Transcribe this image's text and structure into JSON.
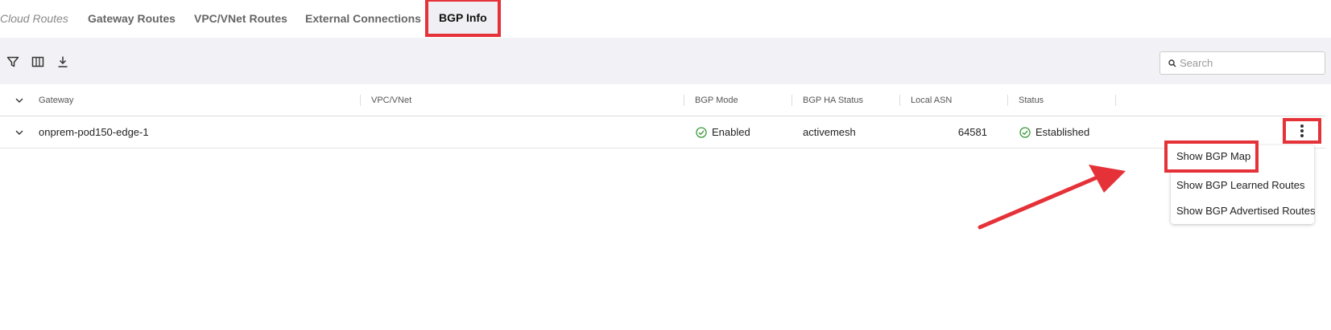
{
  "tabs": [
    {
      "label": "Cloud Routes"
    },
    {
      "label": "Gateway Routes"
    },
    {
      "label": "VPC/VNet Routes"
    },
    {
      "label": "External Connections"
    },
    {
      "label": "BGP Info",
      "active": true
    }
  ],
  "toolbar": {
    "icons": [
      "filter-icon",
      "columns-icon",
      "download-icon"
    ],
    "search_placeholder": "Search"
  },
  "table": {
    "columns": [
      "Gateway",
      "VPC/VNet",
      "BGP Mode",
      "BGP HA Status",
      "Local ASN",
      "Status"
    ],
    "rows": [
      {
        "gateway": "onprem-pod150-edge-1",
        "vpc_vnet": "",
        "bgp_mode": "Enabled",
        "bgp_ha_status": "activemesh",
        "local_asn": "64581",
        "status": "Established"
      }
    ]
  },
  "context_menu": {
    "items": [
      "Show BGP Map",
      "Show BGP Learned Routes",
      "Show BGP Advertised Routes"
    ]
  },
  "colors": {
    "highlight": "#e53238",
    "success": "#3a9a3a",
    "toolbar_bg": "#f2f2f6"
  }
}
